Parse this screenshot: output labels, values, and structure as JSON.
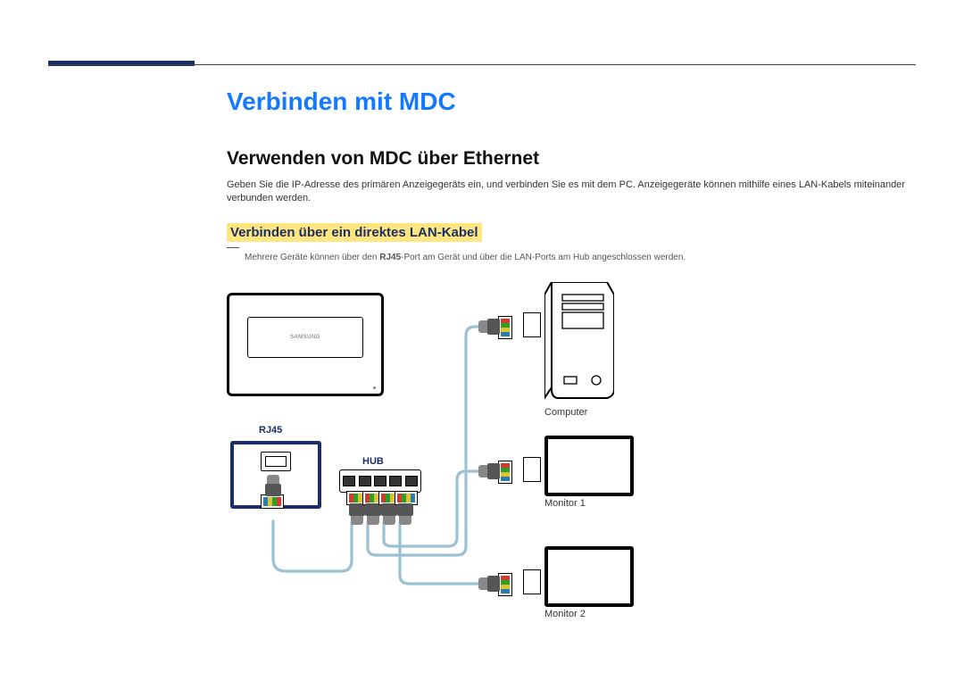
{
  "header": {
    "section_title": "Verbinden mit MDC",
    "sub_title": "Verwenden von MDC über Ethernet",
    "intro_text": "Geben Sie die IP-Adresse des primären Anzeigegeräts ein, und verbinden Sie es mit dem PC. Anzeigegeräte können mithilfe eines LAN-Kabels miteinander verbunden werden.",
    "lead_highlight": "Verbinden über ein direktes LAN-Kabel",
    "note_prefix": "Mehrere Geräte können über den ",
    "note_bold": "RJ45",
    "note_suffix": "-Port am Gerät und über die LAN-Ports am Hub angeschlossen werden."
  },
  "diagram": {
    "display_logo": "SAMSUNG",
    "label_rj45": "RJ45",
    "label_hub": "HUB",
    "label_computer": "Computer",
    "label_monitor1": "Monitor 1",
    "label_monitor2": "Monitor 2"
  },
  "colors": {
    "accent": "#1c2e66",
    "link": "#1379ff",
    "highlight_bg": "#ffe680",
    "cable": "#9cc1d1"
  }
}
